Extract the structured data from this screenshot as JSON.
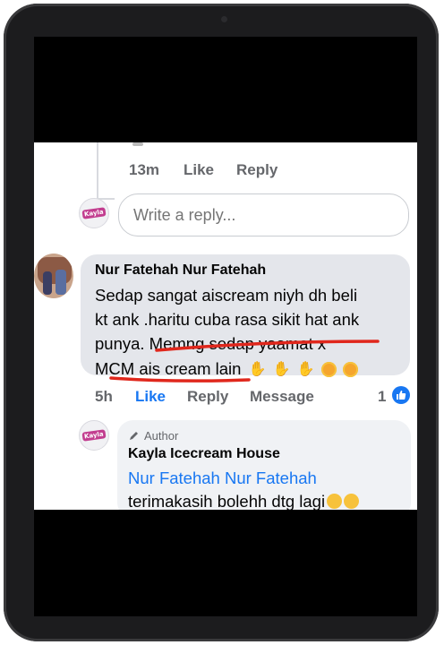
{
  "top_comment": {
    "time": "13m",
    "like": "Like",
    "reply": "Reply"
  },
  "reply_input": {
    "placeholder": "Write a reply..."
  },
  "comment": {
    "author": "Nur Fatehah Nur Fatehah",
    "text_line1": "Sedap sangat aiscream niyh dh beli",
    "text_line2": "kt ank .haritu cuba rasa sikit hat ank",
    "text_line3": "punya. Memng sedap yaamat  x",
    "text_line4": "MCM ais cream lain",
    "time": "5h",
    "like": "Like",
    "reply": "Reply",
    "message": "Message",
    "reaction_count": "1"
  },
  "author_reply": {
    "badge": "Author",
    "name": "Kayla Icecream House",
    "mention": "Nur Fatehah Nur Fatehah",
    "text": "terimakasih bolehh dtg lagi"
  },
  "brand_logo_text": "Kayla",
  "colors": {
    "link": "#1877f2",
    "underline": "#e0271c",
    "bubble": "#e4e6eb"
  },
  "icons": [
    "pencil-icon",
    "like-reaction-icon",
    "thumbs-up-emoji",
    "smiling-face-hearts-emoji"
  ]
}
